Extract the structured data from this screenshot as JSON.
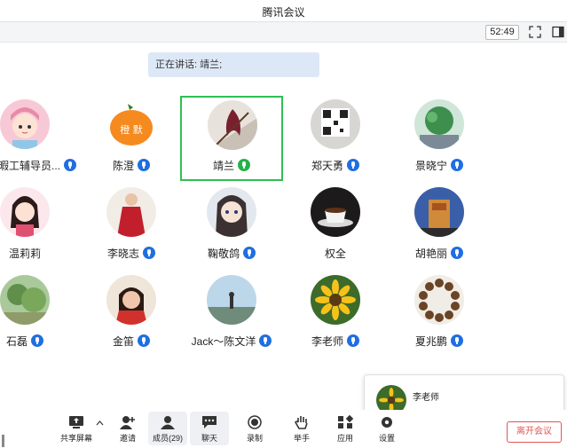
{
  "window": {
    "title": "腾讯会议"
  },
  "toolbar": {
    "timer": "52:49"
  },
  "speaker": {
    "text": "正在讲话: 靖兰;"
  },
  "participants": [
    {
      "name": "暇工辅导员...",
      "talking": false
    },
    {
      "name": "陈澄",
      "talking": false
    },
    {
      "name": "靖兰",
      "talking": true
    },
    {
      "name": "郑天勇",
      "talking": false
    },
    {
      "name": "景晓宁",
      "talking": false
    },
    {
      "name": "温莉莉",
      "talking": false
    },
    {
      "name": "李晓志",
      "talking": false
    },
    {
      "name": "鞠敬鸽",
      "talking": false
    },
    {
      "name": "权全",
      "talking": false
    },
    {
      "name": "胡艳丽",
      "talking": false
    },
    {
      "name": "石磊",
      "talking": false
    },
    {
      "name": "金笛",
      "talking": false
    },
    {
      "name": "Jack～陈文洋",
      "talking": false
    },
    {
      "name": "李老师",
      "talking": false
    },
    {
      "name": "夏兆鹏",
      "talking": false
    }
  ],
  "avatar_text": {
    "chenchen": "橙 默"
  },
  "bottom": {
    "share": "共享屏幕",
    "invite": "邀请",
    "members": "成员(29)",
    "chat": "聊天",
    "record": "录制",
    "raise": "举手",
    "apps": "应用",
    "settings": "设置"
  },
  "popup": {
    "name": "李老师"
  },
  "leave": "离开会议",
  "colors": {
    "talk_green": "#24b24b",
    "mic_blue": "#1f6fe0",
    "leave_red": "#e25555"
  }
}
